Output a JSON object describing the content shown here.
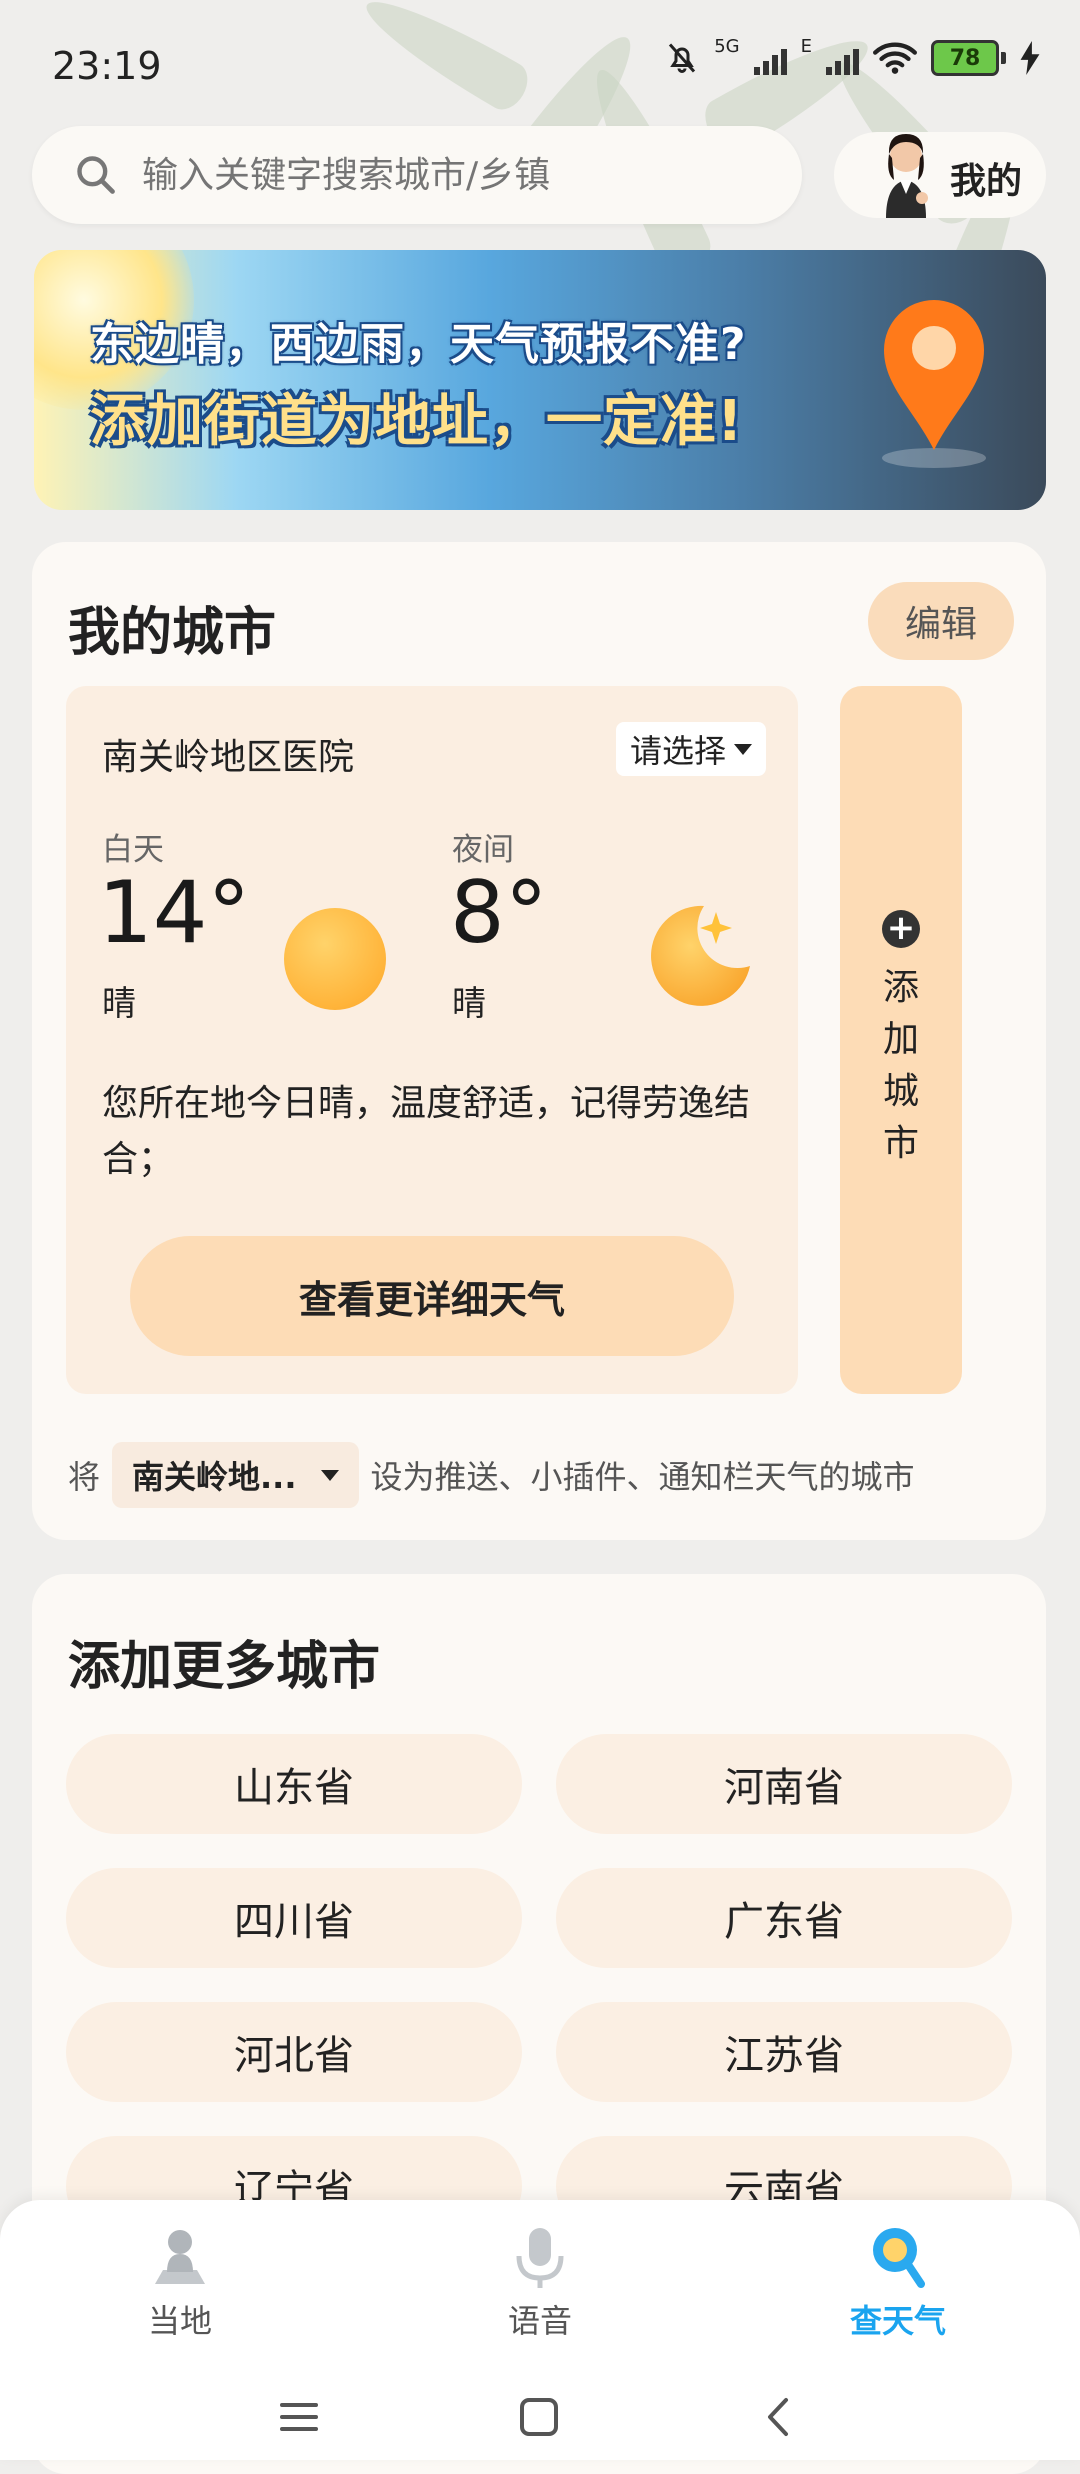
{
  "status_bar": {
    "time": "23:19",
    "network": "5G",
    "network2": "E",
    "battery": "78"
  },
  "search": {
    "placeholder": "输入关键字搜索城市/乡镇"
  },
  "profile": {
    "label": "我的"
  },
  "banner": {
    "line1": "东边晴，西边雨，天气预报不准?",
    "line2": "添加街道为地址，一定准!"
  },
  "my_cities": {
    "title": "我的城市",
    "edit_label": "编辑",
    "card": {
      "city_name": "南关岭地区医院",
      "select_label": "请选择",
      "day": {
        "label": "白天",
        "temp": "14°",
        "condition": "晴"
      },
      "night": {
        "label": "夜间",
        "temp": "8°",
        "condition": "晴"
      },
      "description": "您所在地今日晴，温度舒适，记得劳逸结合；",
      "detail_button": "查看更详细天气"
    },
    "add_city_label": "添加城市",
    "push": {
      "prefix": "将",
      "selected": "南关岭地...",
      "suffix": "设为推送、小插件、通知栏天气的城市"
    }
  },
  "more_cities": {
    "title": "添加更多城市",
    "provinces": [
      "山东省",
      "河南省",
      "四川省",
      "广东省",
      "河北省",
      "江苏省",
      "辽宁省",
      "云南省"
    ]
  },
  "bottom_nav": {
    "items": [
      {
        "label": "当地",
        "icon": "location-person-icon"
      },
      {
        "label": "语音",
        "icon": "microphone-icon"
      },
      {
        "label": "查天气",
        "icon": "search-weather-icon",
        "active": true
      }
    ]
  },
  "colors": {
    "accent": "#1aa4ef",
    "button_peach": "#fddcb6",
    "card_bg": "#fcf9f5"
  }
}
